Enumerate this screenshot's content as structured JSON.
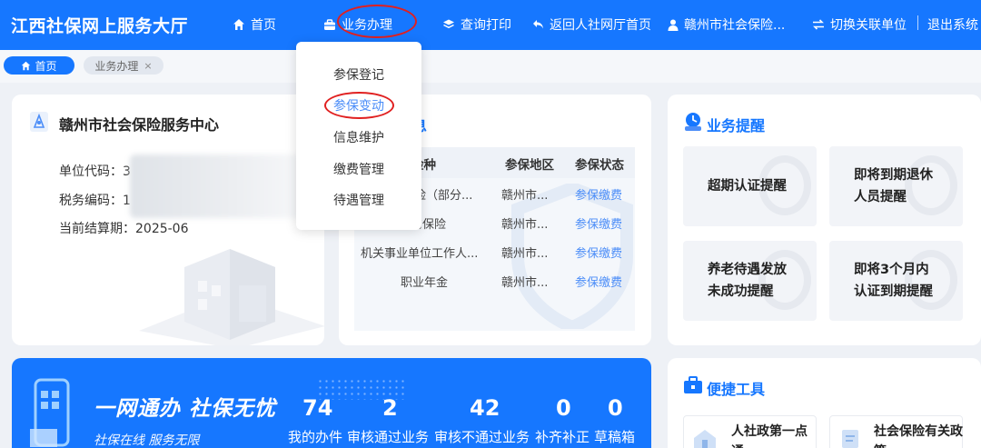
{
  "header": {
    "brand": "江西社保网上服务大厅",
    "nav": [
      {
        "label": "首页",
        "icon": "home-icon"
      },
      {
        "label": "业务办理",
        "icon": "briefcase-icon"
      },
      {
        "label": "查询打印",
        "icon": "layers-icon"
      },
      {
        "label": "返回人社网厅首页",
        "icon": "return-arrow-icon"
      },
      {
        "label": "赣州市社会保险...",
        "icon": "user-icon"
      },
      {
        "label": "切换关联单位",
        "icon": "switch-icon"
      },
      {
        "label": "退出系统",
        "icon": ""
      }
    ]
  },
  "tabs": {
    "home": "首页",
    "business": "业务办理",
    "close": "×"
  },
  "dropdown": {
    "items": [
      "参保登记",
      "参保变动",
      "信息维护",
      "缴费管理",
      "待遇管理"
    ]
  },
  "unit": {
    "name": "赣州市社会保险服务中心",
    "code_label": "单位代码：",
    "code_value": "3",
    "tax_label": "税务编码：",
    "tax_value": "1",
    "period_label": "当前结算期：",
    "period_value": "2025-06"
  },
  "insurance": {
    "title": "信息",
    "columns": [
      "险种",
      "参保地区",
      "参保状态"
    ],
    "rows": [
      {
        "type": "险（部分...",
        "region": "赣州市...",
        "status": "参保缴费"
      },
      {
        "type": "伤保险",
        "region": "赣州市...",
        "status": "参保缴费"
      },
      {
        "type": "机关事业单位工作人...",
        "region": "赣州市...",
        "status": "参保缴费"
      },
      {
        "type": "职业年金",
        "region": "赣州市...",
        "status": "参保缴费"
      }
    ]
  },
  "reminders": {
    "title": "业务提醒",
    "items": [
      [
        "超期认证提醒"
      ],
      [
        "即将到期退休",
        "人员提醒"
      ],
      [
        "养老待遇发放",
        "未成功提醒"
      ],
      [
        "即将3个月内",
        "认证到期提醒"
      ]
    ]
  },
  "banner": {
    "title": "一网通办 社保无忧",
    "subtitle": "社保在线  服务无限",
    "stats": [
      {
        "value": "74",
        "label": "我的办件"
      },
      {
        "value": "2",
        "label": "审核通过业务"
      },
      {
        "value": "42",
        "label": "审核不通过业务"
      },
      {
        "value": "0",
        "label": "补齐补正"
      },
      {
        "value": "0",
        "label": "草稿箱"
      }
    ]
  },
  "tools": {
    "title": "便捷工具",
    "items": [
      [
        "人社政第一点",
        "通"
      ],
      [
        "社会保险有关政",
        "策"
      ]
    ]
  },
  "colors": {
    "primary": "#1677ff",
    "link": "#4b8df8",
    "highlight_ring": "#e02020",
    "page_bg": "#eef1f6"
  }
}
